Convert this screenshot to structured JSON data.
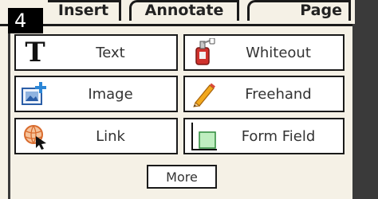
{
  "badge": "4",
  "tabs": [
    {
      "label": "Insert"
    },
    {
      "label": "Annotate"
    },
    {
      "label": "Page"
    }
  ],
  "tools": {
    "text": {
      "label": "Text",
      "icon": "text-T-icon"
    },
    "whiteout": {
      "label": "Whiteout",
      "icon": "whiteout-bottle-icon"
    },
    "image": {
      "label": "Image",
      "icon": "image-add-icon"
    },
    "freehand": {
      "label": "Freehand",
      "icon": "pencil-icon"
    },
    "link": {
      "label": "Link",
      "icon": "link-globe-icon"
    },
    "form_field": {
      "label": "Form Field",
      "icon": "form-field-icon"
    }
  },
  "more_label": "More",
  "colors": {
    "panel_bg": "#f5f1e6",
    "border": "#1a1a1a",
    "outside": "#3a3a3a"
  }
}
